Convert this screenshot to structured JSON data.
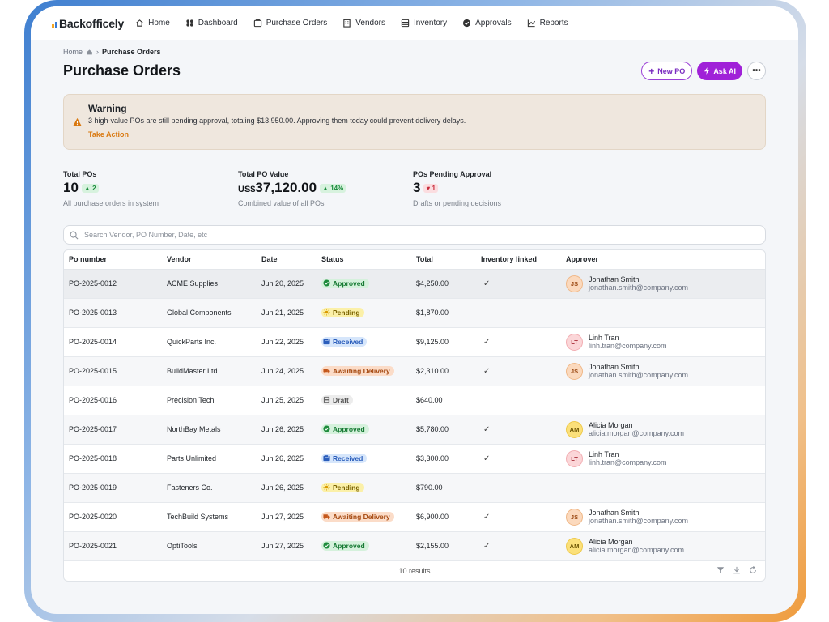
{
  "brand": {
    "name": "Backofficely"
  },
  "nav": [
    {
      "label": "Home",
      "icon": "home-icon"
    },
    {
      "label": "Dashboard",
      "icon": "dashboard-icon"
    },
    {
      "label": "Purchase Orders",
      "icon": "purchase-orders-icon"
    },
    {
      "label": "Vendors",
      "icon": "vendors-icon"
    },
    {
      "label": "Inventory",
      "icon": "inventory-icon"
    },
    {
      "label": "Approvals",
      "icon": "approvals-icon"
    },
    {
      "label": "Reports",
      "icon": "reports-icon"
    }
  ],
  "breadcrumb": {
    "home": "Home",
    "current": "Purchase Orders"
  },
  "page": {
    "title": "Purchase Orders"
  },
  "actions": {
    "new_po": "New PO",
    "ask_ai": "Ask AI",
    "more": "•••"
  },
  "warning": {
    "title": "Warning",
    "message": "3 high-value POs are still pending approval, totaling $13,950.00. Approving them today could prevent delivery delays.",
    "action": "Take Action"
  },
  "stats": [
    {
      "label": "Total POs",
      "prefix": "",
      "value": "10",
      "delta": "2",
      "direction": "up",
      "desc": "All purchase orders in system"
    },
    {
      "label": "Total PO Value",
      "prefix": "US$",
      "value": "37,120.00",
      "delta": "14%",
      "direction": "up",
      "desc": "Combined value of all POs"
    },
    {
      "label": "POs Pending Approval",
      "prefix": "",
      "value": "3",
      "delta": "1",
      "direction": "down",
      "desc": "Drafts or pending decisions"
    }
  ],
  "search": {
    "placeholder": "Search Vendor, PO Number, Date, etc",
    "value": ""
  },
  "table": {
    "columns": [
      "Po number",
      "Vendor",
      "Date",
      "Status",
      "Total",
      "Inventory linked",
      "Approver"
    ],
    "rows": [
      {
        "po": "PO-2025-0012",
        "vendor": "ACME Supplies",
        "date": "Jun 20, 2025",
        "status": "Approved",
        "total": "$4,250.00",
        "linked": "✓",
        "approver": {
          "initials": "JS",
          "name": "Jonathan Smith",
          "email": "jonathan.smith@company.com"
        }
      },
      {
        "po": "PO-2025-0013",
        "vendor": "Global Components",
        "date": "Jun 21, 2025",
        "status": "Pending",
        "total": "$1,870.00",
        "linked": "",
        "approver": null
      },
      {
        "po": "PO-2025-0014",
        "vendor": "QuickParts Inc.",
        "date": "Jun 22, 2025",
        "status": "Received",
        "total": "$9,125.00",
        "linked": "✓",
        "approver": {
          "initials": "LT",
          "name": "Linh Tran",
          "email": "linh.tran@company.com"
        }
      },
      {
        "po": "PO-2025-0015",
        "vendor": "BuildMaster Ltd.",
        "date": "Jun 24, 2025",
        "status": "Awaiting Delivery",
        "total": "$2,310.00",
        "linked": "✓",
        "approver": {
          "initials": "JS",
          "name": "Jonathan Smith",
          "email": "jonathan.smith@company.com"
        }
      },
      {
        "po": "PO-2025-0016",
        "vendor": "Precision Tech",
        "date": "Jun 25, 2025",
        "status": "Draft",
        "total": "$640.00",
        "linked": "",
        "approver": null
      },
      {
        "po": "PO-2025-0017",
        "vendor": "NorthBay Metals",
        "date": "Jun 26, 2025",
        "status": "Approved",
        "total": "$5,780.00",
        "linked": "✓",
        "approver": {
          "initials": "AM",
          "name": "Alicia Morgan",
          "email": "alicia.morgan@company.com"
        }
      },
      {
        "po": "PO-2025-0018",
        "vendor": "Parts Unlimited",
        "date": "Jun 26, 2025",
        "status": "Received",
        "total": "$3,300.00",
        "linked": "✓",
        "approver": {
          "initials": "LT",
          "name": "Linh Tran",
          "email": "linh.tran@company.com"
        }
      },
      {
        "po": "PO-2025-0019",
        "vendor": "Fasteners Co.",
        "date": "Jun 26, 2025",
        "status": "Pending",
        "total": "$790.00",
        "linked": "",
        "approver": null
      },
      {
        "po": "PO-2025-0020",
        "vendor": "TechBuild Systems",
        "date": "Jun 27, 2025",
        "status": "Awaiting Delivery",
        "total": "$6,900.00",
        "linked": "✓",
        "approver": {
          "initials": "JS",
          "name": "Jonathan Smith",
          "email": "jonathan.smith@company.com"
        }
      },
      {
        "po": "PO-2025-0021",
        "vendor": "OptiTools",
        "date": "Jun 27, 2025",
        "status": "Approved",
        "total": "$2,155.00",
        "linked": "✓",
        "approver": {
          "initials": "AM",
          "name": "Alicia Morgan",
          "email": "alicia.morgan@company.com"
        }
      }
    ],
    "footer": "10 results"
  },
  "colors": {
    "accent": "#a021d8",
    "warning_action": "#d9780f",
    "approved": "#177a34",
    "pending": "#7a6200",
    "received": "#2a5dbb",
    "awaiting": "#a5480f"
  }
}
